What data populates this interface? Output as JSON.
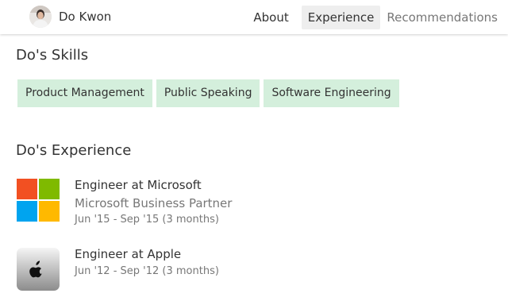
{
  "header": {
    "name": "Do Kwon",
    "nav": [
      {
        "label": "About"
      },
      {
        "label": "Experience"
      },
      {
        "label": "Recommendations"
      }
    ]
  },
  "skills": {
    "title": "Do's Skills",
    "items": [
      "Product Management",
      "Public Speaking",
      "Software Engineering"
    ]
  },
  "experience": {
    "title": "Do's Experience",
    "jobs": [
      {
        "title": "Engineer at Microsoft",
        "company": "Microsoft Business Partner",
        "dates": "Jun '15 - Sep '15 (3 months)",
        "logo": "microsoft-logo"
      },
      {
        "title": "Engineer at Apple",
        "dates": "Jun '12 - Sep '12 (3 months)",
        "logo": "apple-logo"
      }
    ]
  },
  "colors": {
    "skill_bg": "#d4efdc",
    "nav_active_bg": "#eeeeee",
    "ms_red": "#f25022",
    "ms_green": "#7fba00",
    "ms_blue": "#00a4ef",
    "ms_yellow": "#ffb900"
  }
}
